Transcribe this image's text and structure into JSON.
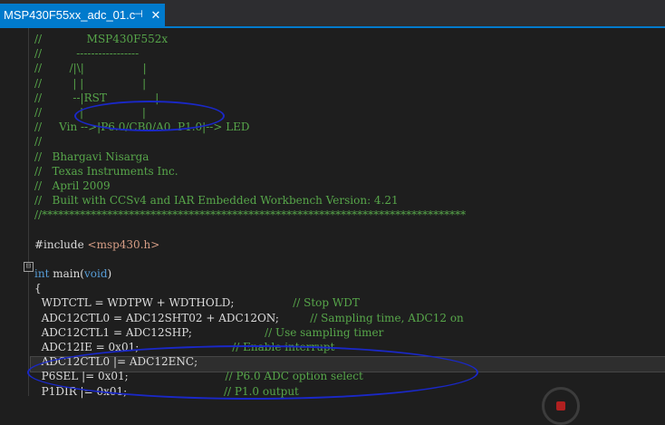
{
  "tab": {
    "title": "MSP430F55xx_adc_01.c",
    "pin": "⊣",
    "close": "✕"
  },
  "code": {
    "lines": [
      "//             MSP430F552x",
      "//          -----------------",
      "//        /|\\|                 |",
      "//         | |                 |",
      "//         --|RST              |",
      "//           |                 |",
      "//     Vin -->|P6.0/CB0/A0  P1.0|--> LED",
      "//",
      "//   Bhargavi Nisarga",
      "//   Texas Instruments Inc.",
      "//   April 2009",
      "//   Built with CCSv4 and IAR Embedded Workbench Version: 4.21",
      "//******************************************************************************",
      "",
      "#include <msp430.h>",
      "",
      "int main(void)",
      "{",
      "  WDTCTL = WDTPW + WDTHOLD;                 // Stop WDT",
      "  ADC12CTL0 = ADC12SHT02 + ADC12ON;         // Sampling time, ADC12 on",
      "  ADC12CTL1 = ADC12SHP;                     // Use sampling timer",
      "  ADC12IE = 0x01;                           // Enable interrupt",
      "  ADC12CTL0 |= ADC12ENC;",
      "  P6SEL |= 0x01;                            // P6.0 ADC option select",
      "  P1DIR |= 0x01;                            // P1.0 output"
    ]
  },
  "include_line": {
    "directive": "#include ",
    "path": "<msp430.h>"
  },
  "main_line": {
    "type": "int",
    "name": " main(",
    "arg": "void",
    "close": ")"
  },
  "brace": "{",
  "statements": [
    {
      "code": "  WDTCTL = WDTPW + WDTHOLD;",
      "pad": "                 ",
      "comment": "// Stop WDT"
    },
    {
      "code": "  ADC12CTL0 = ADC12SHT02 + ADC12ON;",
      "pad": "         ",
      "comment": "// Sampling time, ADC12 on"
    },
    {
      "code": "  ADC12CTL1 = ADC12SHP;",
      "pad": "                     ",
      "comment": "// Use sampling timer"
    },
    {
      "code": "  ADC12IE = 0x01;",
      "pad": "                           ",
      "comment": "// Enable interrupt"
    },
    {
      "code": "  ADC12CTL0 |= ADC12ENC;",
      "pad": "",
      "comment": ""
    },
    {
      "code": "  P6SEL |= 0x01;",
      "pad": "                            ",
      "comment": "// P6.0 ADC option select"
    },
    {
      "code": "  P1DIR |= 0x01;",
      "pad": "                            ",
      "comment": "// P1.0 output"
    }
  ],
  "colors": {
    "comment": "#57a64a",
    "keyword": "#569cd6",
    "string": "#d69d85",
    "text": "#dcdcdc",
    "tab_accent": "#007acc",
    "annotation": "#1a28c8"
  },
  "icons": {
    "fold_minus": "⊟",
    "fold_minus2": "⊟"
  }
}
